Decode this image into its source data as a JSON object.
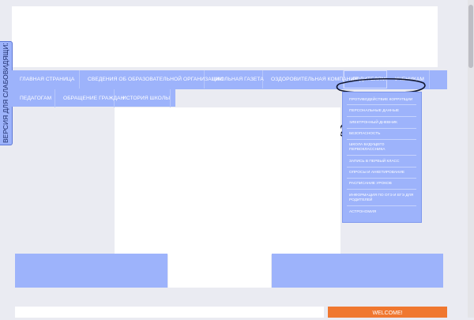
{
  "side_tab": {
    "label": "ВЕРСИЯ ДЛЯ СЛАБОВИДЯЩИХ"
  },
  "nav": {
    "row1": [
      "ГЛАВНАЯ СТРАНИЦА",
      "СВЕДЕНИЯ ОБ ОБРАЗОВАТЕЛЬНОЙ ОРГАНИЗАЦИИ",
      "ШКОЛЬНАЯ ГАЗЕТА",
      "ОЗДОРОВИТЕЛЬНАЯ КОМПАНИЯ",
      "РОДИТЕЛЯМ",
      "УЧЕНИКАМ"
    ],
    "row2": [
      "ПЕДАГОГАМ",
      "ОБРАЩЕНИЕ ГРАЖДАН",
      "ИСТОРИЯ ШКОЛЫ"
    ],
    "selected": "РОДИТЕЛЯМ"
  },
  "dropdown": {
    "items": [
      [
        "ПРОТИВОДЕЙСТВИЕ КОРРУПЦИИ"
      ],
      [
        "ПЕРСОНАЛЬНЫЕ ДАННЫЕ"
      ],
      [
        "ЭЛЕКТРОННЫЙ ДНЕВНИК"
      ],
      [
        "БЕЗОПАСНОСТЬ"
      ],
      [
        "ШКОЛА БУДУЩЕГО",
        "ПЕРВОКЛАССНИКА"
      ],
      [
        "ЗАПИСЬ В ПЕРВЫЙ КЛАСС"
      ],
      [
        "ОПРОСЫ И АНКЕТИРОВАНИЕ"
      ],
      [
        "РАСПИСАНИЕ УРОКОВ"
      ],
      [
        "ИНФОРМАЦИЯ ПО ОГЭ И ЕГЭ ДЛЯ",
        "РОДИТЕЛЕЙ"
      ],
      [
        "АСТРОНОМИЯ"
      ]
    ]
  },
  "welcome": {
    "label": "WELCOME!"
  },
  "colors": {
    "nav_blue": "#9db3fb",
    "page_bg": "#eaebf2",
    "accent_orange": "#f0772f",
    "annotation_ink": "#10162e"
  }
}
